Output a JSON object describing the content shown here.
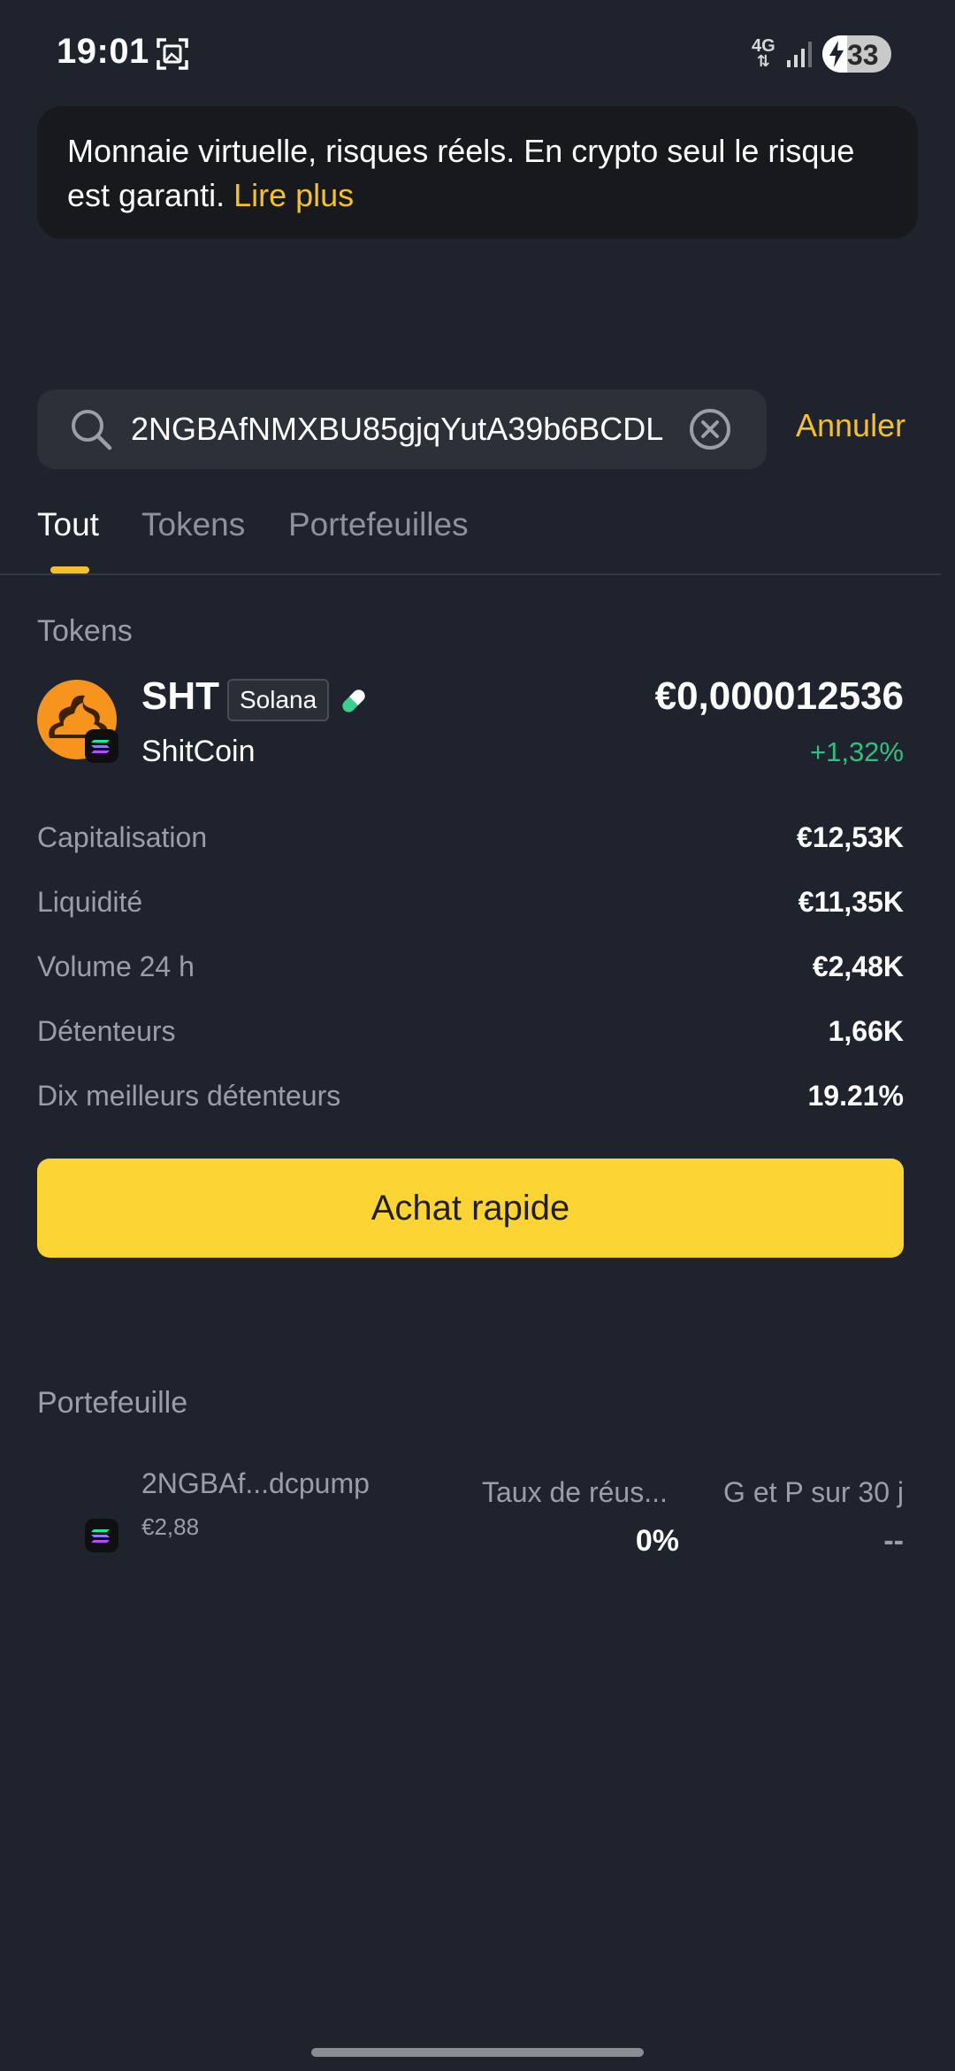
{
  "status_bar": {
    "time": "19:01",
    "network_top": "4G",
    "battery": "33",
    "icons": [
      "screenshot-icon",
      "network-4g-icon",
      "signal-icon",
      "battery-charging-icon"
    ]
  },
  "banner": {
    "text": "Monnaie virtuelle, risques réels. En crypto seul le risque est garanti. ",
    "link": "Lire plus"
  },
  "search": {
    "value": "2NGBAfNMXBU85gjqYutA39b6BCDL",
    "cancel_label": "Annuler"
  },
  "tabs": [
    {
      "label": "Tout",
      "active": true
    },
    {
      "label": "Tokens",
      "active": false
    },
    {
      "label": "Portefeuilles",
      "active": false
    }
  ],
  "tokens_section": {
    "title": "Tokens",
    "token": {
      "symbol": "SHT",
      "chain": "Solana",
      "name": "ShitCoin",
      "price": "€0,000012536",
      "change": "+1,32%",
      "change_color": "#30c07e",
      "avatar_color": "#f7941d"
    },
    "stats": [
      {
        "label": "Capitalisation",
        "value": "€12,53K"
      },
      {
        "label": "Liquidité",
        "value": "€11,35K"
      },
      {
        "label": "Volume 24 h",
        "value": "€2,48K"
      },
      {
        "label": "Détenteurs",
        "value": "1,66K"
      },
      {
        "label": "Dix meilleurs détenteurs",
        "value": "19.21%"
      }
    ],
    "quick_buy_label": "Achat rapide"
  },
  "wallet_section": {
    "title": "Portefeuille",
    "address": "2NGBAf...dcpump",
    "balance": "€2,88",
    "col1_label": "Taux de réus...",
    "col1_value": "0%",
    "col2_label": "G et P sur 30 j",
    "col2_value": "--"
  },
  "colors": {
    "background": "#1f232d",
    "accent": "#f5c02e",
    "button": "#fcd535",
    "positive": "#30c07e"
  }
}
